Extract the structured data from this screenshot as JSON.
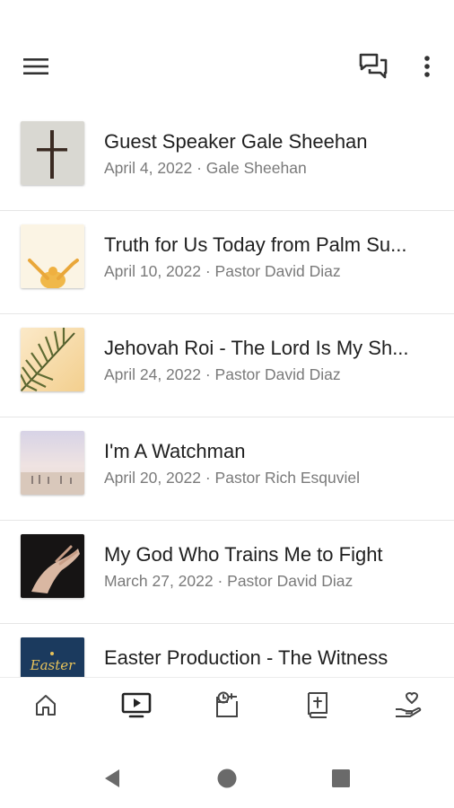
{
  "header": {
    "menu_icon": "hamburger-menu-icon",
    "chat_icon": "chat-bubbles-icon",
    "more_icon": "more-vertical-icon"
  },
  "sermons": [
    {
      "title": "Guest Speaker Gale Sheehan",
      "date": "April 4, 2022",
      "speaker": "Gale Sheehan",
      "meta": "April 4, 2022 · Gale Sheehan",
      "thumbnail": "cross-on-wall"
    },
    {
      "title": "Truth for Us Today from Palm Su...",
      "date": "April 10, 2022",
      "speaker": "Pastor David Diaz",
      "meta": "April 10, 2022 · Pastor David Diaz",
      "thumbnail": "raised-hands"
    },
    {
      "title": "Jehovah Roi - The Lord Is My Sh...",
      "date": "April 24, 2022",
      "speaker": "Pastor David Diaz",
      "meta": "April 24, 2022 · Pastor David Diaz",
      "thumbnail": "palm-leaf"
    },
    {
      "title": "I'm A Watchman",
      "date": "April 20, 2022",
      "speaker": "Pastor Rich Esquviel",
      "meta": "April 20, 2022 · Pastor Rich Esquviel",
      "thumbnail": "beach-people"
    },
    {
      "title": "My God Who Trains Me to Fight",
      "date": "March 27, 2022",
      "speaker": "Pastor David Diaz",
      "meta": "March 27, 2022 · Pastor David Diaz",
      "thumbnail": "open-hand-dark"
    },
    {
      "title": "Easter Production - The Witness",
      "date": "",
      "speaker": "",
      "meta": "",
      "thumbnail": "easter-card",
      "thumbnail_text": "Easter"
    }
  ],
  "bottom_nav": [
    {
      "name": "home",
      "icon": "home-icon"
    },
    {
      "name": "media",
      "icon": "tv-play-icon",
      "active": true
    },
    {
      "name": "events",
      "icon": "calendar-clock-icon"
    },
    {
      "name": "bible",
      "icon": "bible-icon"
    },
    {
      "name": "give",
      "icon": "heart-hand-icon"
    }
  ],
  "system_nav": [
    "back-icon",
    "home-circle-icon",
    "recents-square-icon"
  ],
  "colors": {
    "background": "#ffffff",
    "title": "#202020",
    "meta": "#7a7a7a",
    "icon": "#333333",
    "divider": "#e6e6e6"
  }
}
